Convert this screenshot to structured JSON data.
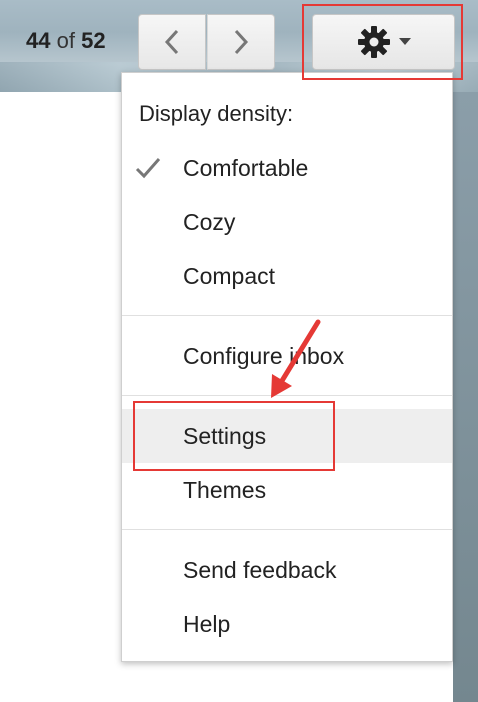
{
  "toolbar": {
    "counter_current": "44",
    "counter_of": "of",
    "counter_total": "52",
    "prev_icon": "chevron-left-icon",
    "next_icon": "chevron-right-icon",
    "settings_icon": "gear-icon",
    "dropdown_icon": "caret-down-icon"
  },
  "menu": {
    "heading": "Display density:",
    "density_options": [
      {
        "label": "Comfortable",
        "checked": true
      },
      {
        "label": "Cozy",
        "checked": false
      },
      {
        "label": "Compact",
        "checked": false
      }
    ],
    "configure_inbox": "Configure inbox",
    "settings": "Settings",
    "themes": "Themes",
    "send_feedback": "Send feedback",
    "help": "Help"
  },
  "colors": {
    "highlight": "#e53935",
    "hover": "#eeeeee"
  }
}
